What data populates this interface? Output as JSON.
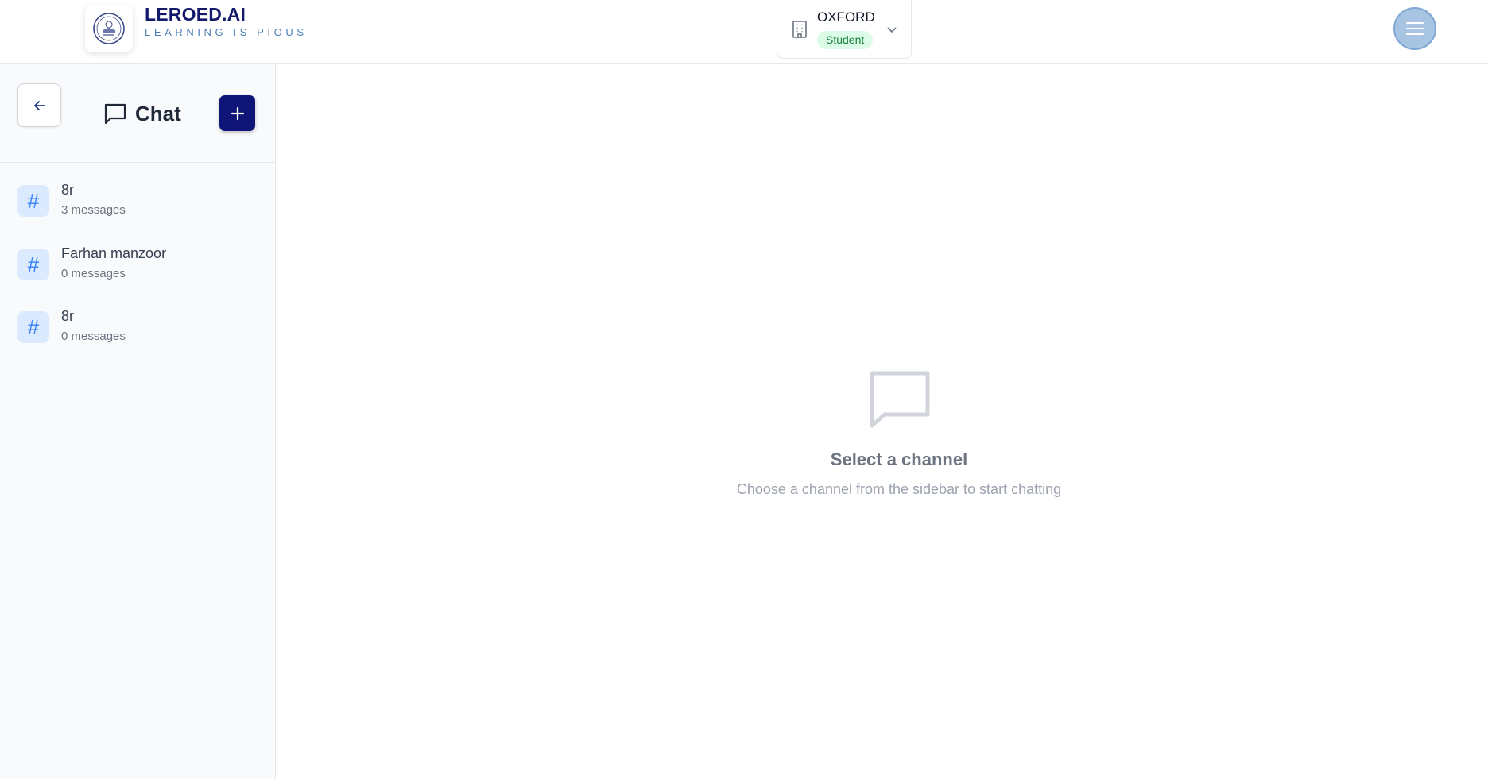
{
  "header": {
    "brand_title": "LEROED.AI",
    "brand_tagline": "LEARNING IS PIOUS",
    "logo_icon": "leroed-logo",
    "org": {
      "name": "OXFORD",
      "role": "Student",
      "icon": "building-icon",
      "dropdown_icon": "chevron-down-icon"
    },
    "menu_icon": "hamburger-menu-icon"
  },
  "sidebar": {
    "title": "Chat",
    "back_icon": "arrow-left-icon",
    "add_icon": "plus-icon",
    "channels": [
      {
        "name": "8r",
        "count": "3 messages"
      },
      {
        "name": "Farhan manzoor",
        "count": "0 messages"
      },
      {
        "name": "8r",
        "count": "0 messages"
      }
    ]
  },
  "main": {
    "empty_title": "Select a channel",
    "empty_subtitle": "Choose a channel from the sidebar to start chatting"
  },
  "colors": {
    "brand": "#141a6b",
    "accent_button": "#0f1477",
    "hash_bg": "#dbeafe",
    "hash_fg": "#3b82f6",
    "role_badge_bg": "#dcfce7",
    "role_badge_fg": "#15803d"
  }
}
